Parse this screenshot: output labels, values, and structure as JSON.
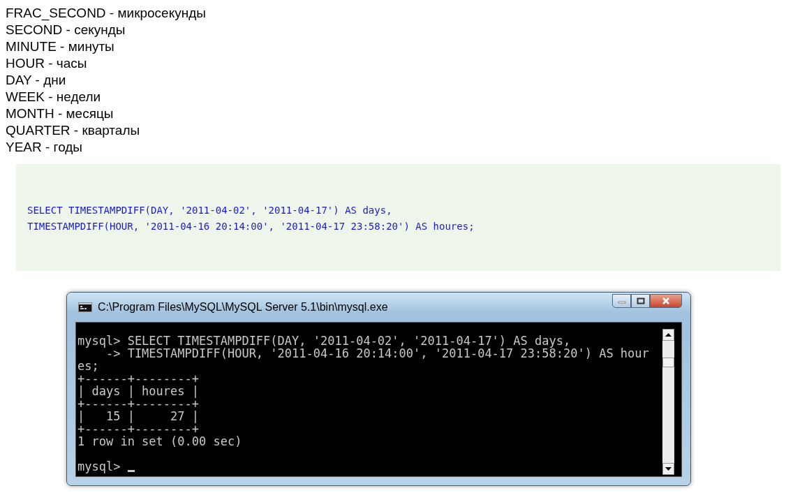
{
  "units": [
    "FRAC_SECOND - микросекунды",
    "SECOND - секунды",
    "MINUTE - минуты",
    "HOUR - часы",
    "DAY - дни",
    "WEEK - недели",
    "MONTH - месяцы",
    "QUARTER - кварталы",
    "YEAR - годы"
  ],
  "code_block": {
    "lines": [
      "SELECT TIMESTAMPDIFF(DAY, '2011-04-02', '2011-04-17') AS days,",
      "TIMESTAMPDIFF(HOUR, '2011-04-16 20:14:00', '2011-04-17 23:58:20') AS houres;"
    ]
  },
  "console_window": {
    "title": "C:\\Program Files\\MySQL\\MySQL Server 5.1\\bin\\mysql.exe",
    "lines": [
      {
        "kind": "text",
        "text": "mysql> SELECT TIMESTAMPDIFF(DAY, '2011-04-02', '2011-04-17') AS days,"
      },
      {
        "kind": "text",
        "text": "    -> TIMESTAMPDIFF(HOUR, '2011-04-16 20:14:00', '2011-04-17 23:58:20') AS hour"
      },
      {
        "kind": "text",
        "text": "es;"
      },
      {
        "kind": "text",
        "text": "+------+--------+"
      },
      {
        "kind": "text",
        "text": "| days | houres |"
      },
      {
        "kind": "text",
        "text": "+------+--------+"
      },
      {
        "kind": "text",
        "text": "|   15 |     27 |"
      },
      {
        "kind": "text",
        "text": "+------+--------+"
      },
      {
        "kind": "text",
        "text": "1 row in set (0.00 sec)"
      },
      {
        "kind": "blank"
      },
      {
        "kind": "text",
        "text": "mysql> "
      }
    ],
    "cursor": true
  }
}
